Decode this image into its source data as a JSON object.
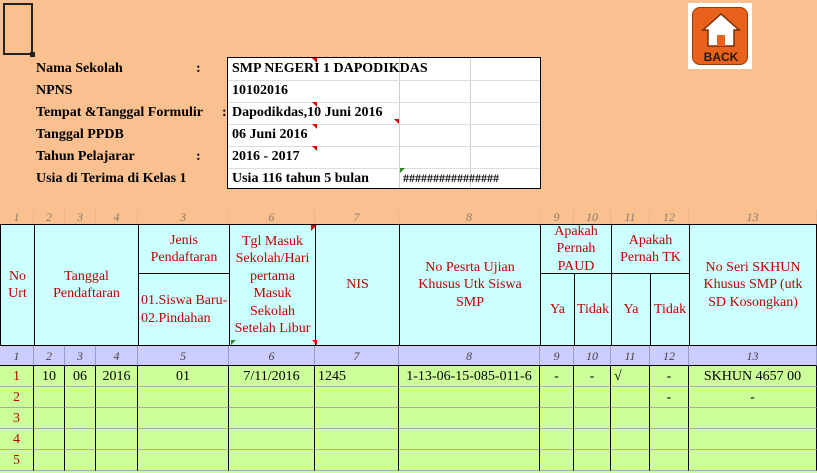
{
  "info": {
    "labels": [
      "Nama Sekolah",
      "NPNS",
      "Tempat &Tanggal Formulir",
      "Tanggal PPDB",
      "Tahun Pelajarar",
      "Usia di Terima di Kelas 1"
    ],
    "colons": [
      ":",
      "",
      ":",
      "",
      ":",
      ""
    ],
    "values": [
      "SMP NEGERI 1 DAPODIKDAS",
      "10102016",
      "Dapodikdas,10 Juni 2016",
      "06 Juni 2016",
      "2016 - 2017",
      "Usia 116 tahun 5 bulan"
    ],
    "overflow": "################"
  },
  "back_button": {
    "label": "BACK",
    "icon": "home-icon"
  },
  "column_numbers_top": [
    "1",
    "2",
    "3",
    "4",
    "3",
    "6",
    "7",
    "8",
    "9",
    "10",
    "11",
    "12",
    "13"
  ],
  "headers": {
    "no_urut": "No Urt",
    "tanggal": "Tanggal Pendaftaran",
    "jenis": "Jenis Pendaftaran",
    "jenis_opts": "01.Siswa Baru-02.Pindahan",
    "tgl_masuk": "Tgl Masuk Sekolah/Hari pertama Masuk Sekolah Setelah Libur",
    "nis": "NIS",
    "no_peserta": "No Pesrta Ujian Khusus Utk Siswa SMP",
    "paud": "Apakah Pernah PAUD",
    "tk": "Apakah Pernah TK",
    "ya": "Ya",
    "tidak": "Tidak",
    "skhun": "No Seri SKHUN Khusus SMP (utk SD Kosongkan)"
  },
  "column_numbers": [
    "1",
    "2",
    "3",
    "4",
    "5",
    "6",
    "7",
    "8",
    "9",
    "10",
    "11",
    "12",
    "13"
  ],
  "rows": [
    {
      "no": "1",
      "d": "10",
      "m": "06",
      "y": "2016",
      "jenis": "01",
      "tgl": "7/11/2016",
      "nis": "1245",
      "peserta": "1-13-06-15-085-011-6",
      "paud_ya": "-",
      "paud_tidak": "-",
      "tk_ya": "√",
      "tk_tidak": "-",
      "skhun": "SKHUN 4657 00"
    },
    {
      "no": "2",
      "d": "",
      "m": "",
      "y": "",
      "jenis": "",
      "tgl": "",
      "nis": "",
      "peserta": "",
      "paud_ya": "",
      "paud_tidak": "",
      "tk_ya": "",
      "tk_tidak": "-",
      "skhun": "-"
    },
    {
      "no": "3",
      "d": "",
      "m": "",
      "y": "",
      "jenis": "",
      "tgl": "",
      "nis": "",
      "peserta": "",
      "paud_ya": "",
      "paud_tidak": "",
      "tk_ya": "",
      "tk_tidak": "",
      "skhun": ""
    },
    {
      "no": "4",
      "d": "",
      "m": "",
      "y": "",
      "jenis": "",
      "tgl": "",
      "nis": "",
      "peserta": "",
      "paud_ya": "",
      "paud_tidak": "",
      "tk_ya": "",
      "tk_tidak": "",
      "skhun": ""
    },
    {
      "no": "5",
      "d": "",
      "m": "",
      "y": "",
      "jenis": "",
      "tgl": "",
      "nis": "",
      "peserta": "",
      "paud_ya": "",
      "paud_tidak": "",
      "tk_ya": "",
      "tk_tidak": "",
      "skhun": ""
    }
  ]
}
